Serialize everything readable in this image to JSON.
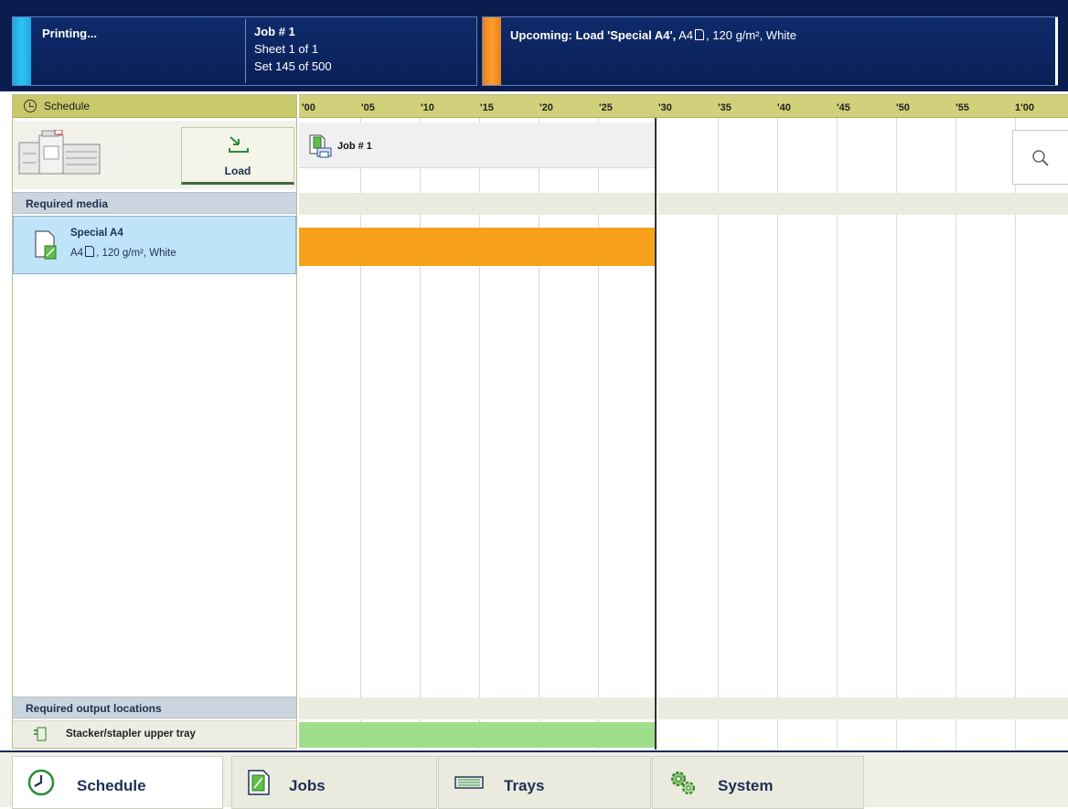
{
  "status_bar": {
    "state": "Printing...",
    "job_title": "Job # 1",
    "sheet": "Sheet 1 of 1",
    "set": "Set 145 of 500",
    "upcoming_prefix": "Upcoming: Load 'Special A4',",
    "upcoming_size": "A4",
    "upcoming_rest": ", 120 g/m², White"
  },
  "left_pane": {
    "schedule_header": "Schedule",
    "load_button": "Load",
    "required_media_header": "Required media",
    "media": {
      "name": "Special A4",
      "size": "A4",
      "rest": ", 120 g/m², White"
    },
    "required_output_header": "Required output locations",
    "output_location": "Stacker/stapler upper tray"
  },
  "timeline": {
    "ticks": [
      "'00",
      "'05",
      "'10",
      "'15",
      "'20",
      "'25",
      "'30",
      "'35",
      "'40",
      "'45",
      "'50",
      "'55",
      "1'00"
    ],
    "job_label": "Job # 1"
  },
  "tabs": [
    {
      "label": "Schedule",
      "icon": "clock-icon",
      "active": true
    },
    {
      "label": "Jobs",
      "icon": "job-document-icon",
      "active": false
    },
    {
      "label": "Trays",
      "icon": "tray-stack-icon",
      "active": false
    },
    {
      "label": "System",
      "icon": "gears-icon",
      "active": false
    }
  ],
  "colors": {
    "top_bar": "#0b1d4e",
    "status_accent": "#2fc4f2",
    "upcoming_accent": "#ff9d2e",
    "schedule_header": "#c9c96c",
    "media_selected": "#bfe3f8",
    "media_bar": "#f7a11a",
    "output_bar": "#9fdf8c"
  }
}
